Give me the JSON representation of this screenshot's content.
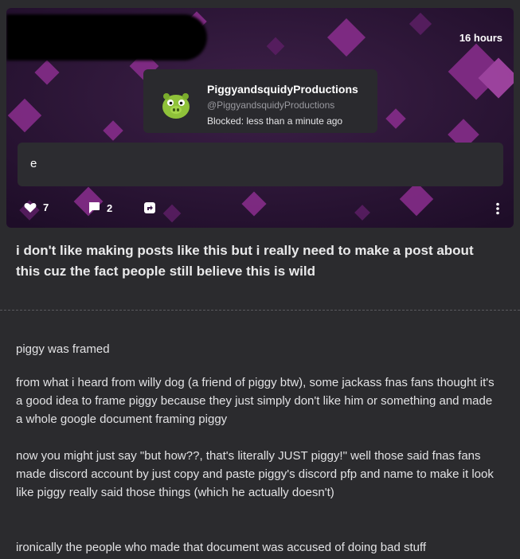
{
  "header": {
    "timestamp": "16 hours",
    "blocked_card": {
      "username": "PiggyandsquidyProductions",
      "handle": "@PiggyandsquidyProductions",
      "status": "Blocked: less than a minute ago",
      "avatar_icon": "green-pig-icon"
    },
    "comment": "e",
    "actions": {
      "likes": "7",
      "comments": "2",
      "like_icon": "heart-icon",
      "comment_icon": "speech-bubble-icon",
      "share_icon": "share-icon",
      "more_icon": "vertical-dots-icon"
    }
  },
  "post": {
    "title": "i don't like making posts like this but i really need to make a post about this cuz the fact people still believe this is wild",
    "paragraphs": [
      "piggy was framed",
      "from what i heard from willy dog (a friend of piggy btw), some jackass fnas fans thought it's a good idea to frame piggy because they just simply don't like him or something and made a whole google document framing piggy",
      "now you might just say \"but how??, that's literally JUST piggy!\" well those said fnas fans made discord account by just copy and paste piggy's discord pfp and name to make it look like piggy really said those things (which he actually doesn't)",
      "ironically the people who made that document was accused of doing bad stuff"
    ]
  },
  "colors": {
    "background": "#2b2b2e",
    "header_purple": "#3a1a4a",
    "diamond": "#9b3aa0"
  }
}
